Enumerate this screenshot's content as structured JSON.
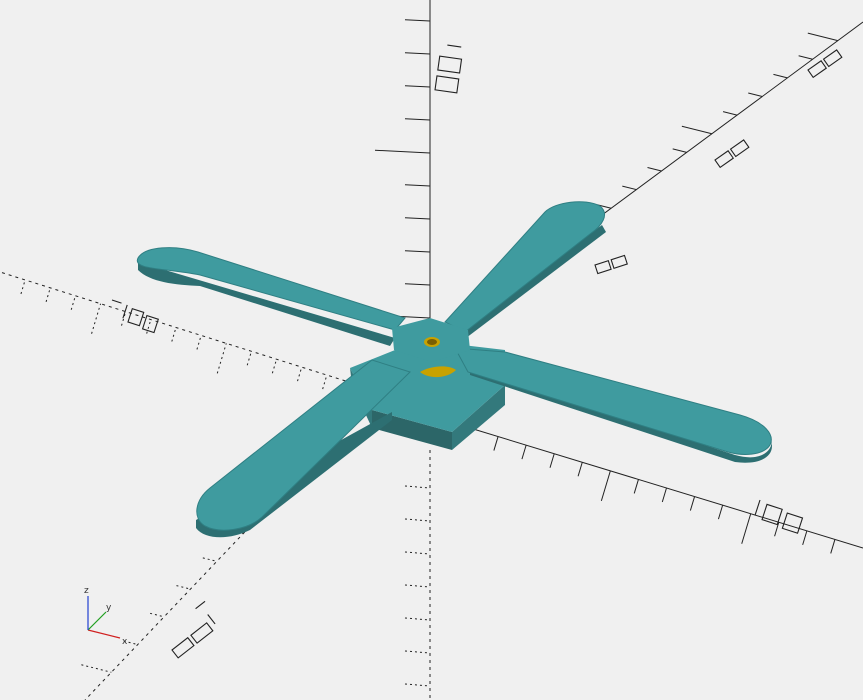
{
  "viewport": {
    "background": "#f0f0f0",
    "model_color": "#3f9b9f",
    "hole_color": "#c8a200"
  },
  "gizmo": {
    "x_label": "x",
    "y_label": "y",
    "z_label": "z"
  }
}
